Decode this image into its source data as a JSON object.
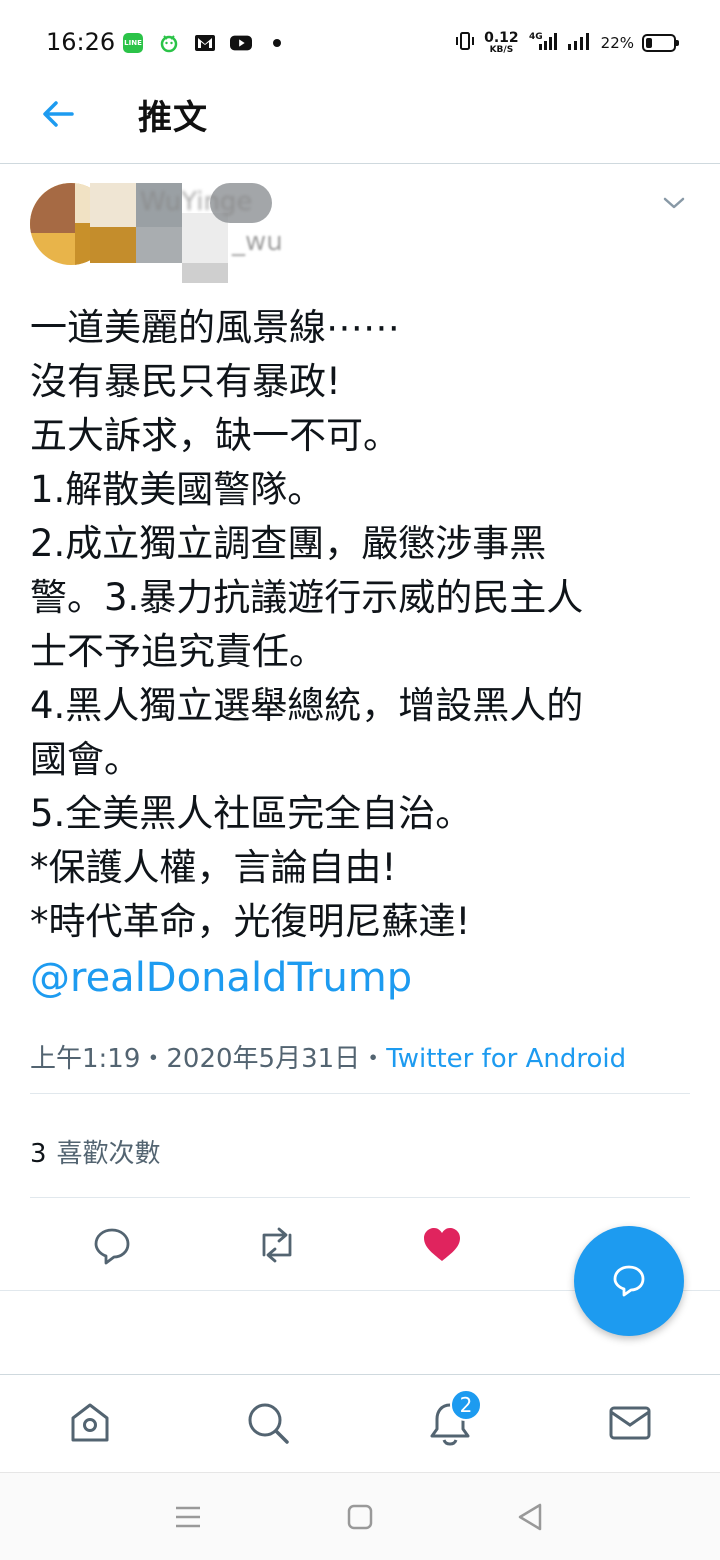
{
  "status_bar": {
    "time": "16:26",
    "net_speed_value": "0.12",
    "net_speed_unit": "KB/S",
    "network": "4G",
    "battery_percent": "22%",
    "battery_level": 0.22,
    "left_icons": [
      "line-icon",
      "notification-icon",
      "gmail-icon",
      "youtube-icon",
      "dot-icon"
    ]
  },
  "header": {
    "title": "推文"
  },
  "tweet": {
    "display_name": "WuYinge",
    "handle": "_wu",
    "lines": [
      "一道美麗的風景線⋯⋯",
      "沒有暴民只有暴政!",
      "五大訴求，缺一不可。",
      "1.解散美國警隊。",
      "2.成立獨立調查團，嚴懲涉事黑",
      "警。3.暴力抗議遊行示威的民主人",
      "士不予追究責任。",
      "4.黑人獨立選舉總統，增設黑人的",
      "國會。",
      "5.全美黑人社區完全自治。",
      "*保護人權，言論自由!",
      "*時代革命，光復明尼蘇達!"
    ],
    "mention": "@realDonaldTrump",
    "timestamp": "上午1:19・2020年5月31日・",
    "source": "Twitter for Android",
    "likes_count": "3",
    "likes_label": "喜歡次數"
  },
  "bottom_nav": {
    "notification_badge": "2"
  },
  "colors": {
    "accent": "#1d9bf0",
    "like": "#e0245e",
    "text": "#0f1419",
    "secondary": "#536471"
  }
}
